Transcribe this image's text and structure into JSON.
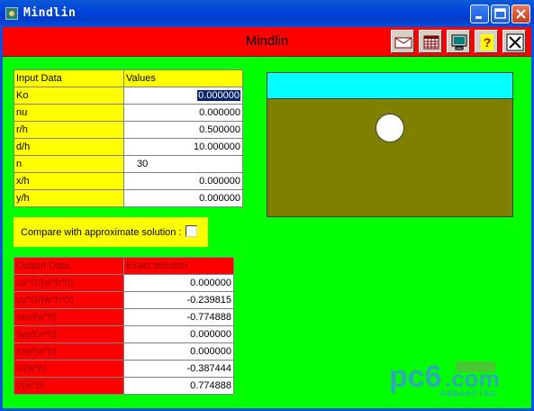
{
  "window": {
    "title": "Mindlin"
  },
  "header": {
    "title": "Mindlin"
  },
  "toolbar": {
    "buttons": [
      {
        "name": "envelope-icon"
      },
      {
        "name": "calculator-icon"
      },
      {
        "name": "monitor-icon"
      },
      {
        "name": "help-icon",
        "label": "?"
      },
      {
        "name": "close-icon",
        "label": "X"
      }
    ]
  },
  "input_table": {
    "headers": [
      "Input Data",
      "Values"
    ],
    "rows": [
      {
        "label": "Ko",
        "value": "0.000000"
      },
      {
        "label": "nu",
        "value": "0.000000"
      },
      {
        "label": "r/h",
        "value": "0.500000"
      },
      {
        "label": "d/h",
        "value": "10.000000"
      },
      {
        "label": "n",
        "value": "30"
      },
      {
        "label": "x/h",
        "value": "0.000000"
      },
      {
        "label": "y/h",
        "value": "0.000000"
      }
    ]
  },
  "compare": {
    "label": "Compare with approximate solution :",
    "checked": false
  },
  "output_table": {
    "headers": [
      "Output Data",
      "Exact solution"
    ],
    "rows": [
      {
        "label": "ux*G/(w*h*h)",
        "value": "0.000000"
      },
      {
        "label": "uy*G/(w*h*h)",
        "value": "-0.239815"
      },
      {
        "label": "sxx/(w*h)",
        "value": "-0.774888"
      },
      {
        "label": "syy/(w*h)",
        "value": "0.000000"
      },
      {
        "label": "sxy/(w*h)",
        "value": "0.000000"
      },
      {
        "label": "s/(w*h)",
        "value": "-0.387444"
      },
      {
        "label": "t/(w*h)",
        "value": "0.774888"
      }
    ]
  },
  "watermark": {
    "brand": "pc6",
    "domain": ".com",
    "tagline": "中国最安全的下载站"
  },
  "colors": {
    "background": "#00ff00",
    "header": "#ff0000",
    "input_labels": "#ffff00",
    "sky": "#00ffff",
    "soil": "#808000"
  }
}
